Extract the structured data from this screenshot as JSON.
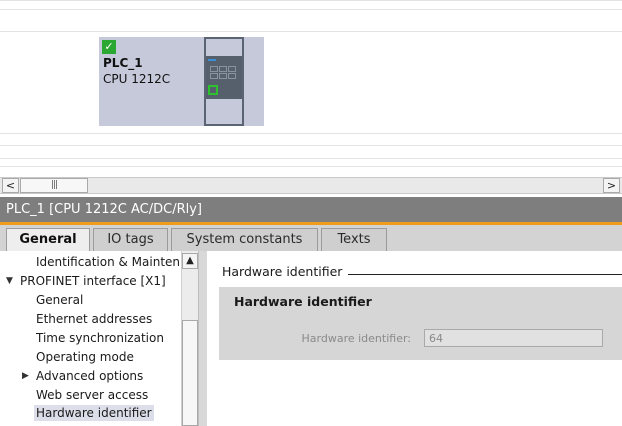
{
  "device": {
    "name": "PLC_1",
    "type": "CPU 1212C",
    "status_icon": "checkmark-icon"
  },
  "scrollbar": {
    "left_icon": "<",
    "right_icon": ">",
    "thumb_grip": "|||"
  },
  "inspector": {
    "title": "PLC_1 [CPU 1212C AC/DC/Rly]",
    "accent_color": "#ef9c1b"
  },
  "tabs": [
    {
      "label": "General",
      "active": true
    },
    {
      "label": "IO tags",
      "active": false
    },
    {
      "label": "System constants",
      "active": false
    },
    {
      "label": "Texts",
      "active": false
    }
  ],
  "nav": {
    "items": [
      {
        "label": "Identification & Mainten…",
        "level": 1,
        "expander": ""
      },
      {
        "label": "PROFINET interface [X1]",
        "level": 0,
        "expander": "expanded"
      },
      {
        "label": "General",
        "level": 1,
        "expander": ""
      },
      {
        "label": "Ethernet addresses",
        "level": 1,
        "expander": ""
      },
      {
        "label": "Time synchronization",
        "level": 1,
        "expander": ""
      },
      {
        "label": "Operating mode",
        "level": 1,
        "expander": ""
      },
      {
        "label": "Advanced options",
        "level": 1,
        "expander": "collapsed"
      },
      {
        "label": "Web server access",
        "level": 1,
        "expander": ""
      },
      {
        "label": "Hardware identifier",
        "level": 1,
        "expander": "",
        "selected": true
      }
    ],
    "scroll_up_icon": "▲"
  },
  "content": {
    "section_title": "Hardware identifier",
    "group_title": "Hardware identifier",
    "field_label": "Hardware identifier:",
    "field_value": "64"
  }
}
